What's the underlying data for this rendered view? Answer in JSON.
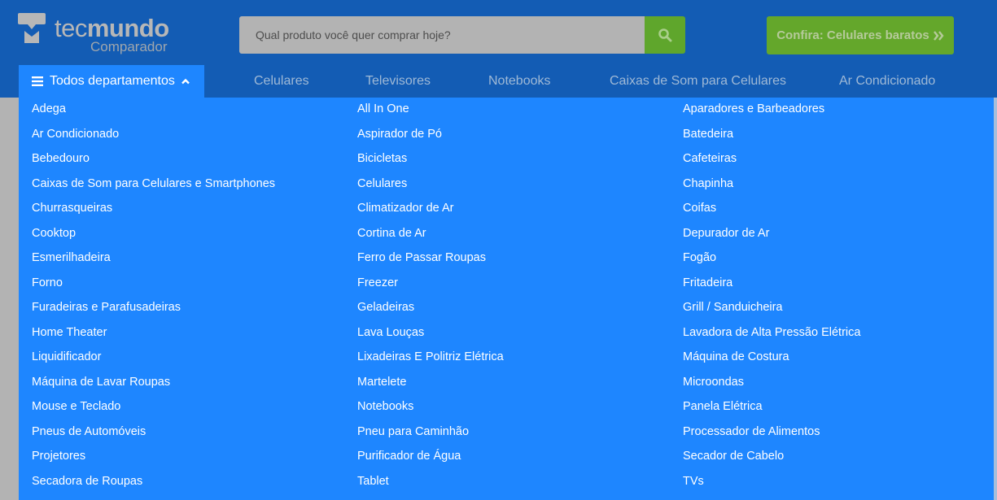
{
  "header": {
    "logo": {
      "brand_light": "tec",
      "brand_bold": "mundo",
      "subtitle": "Comparador"
    },
    "search": {
      "placeholder": "Qual produto você quer comprar hoje?",
      "value": "",
      "icon": "search-icon"
    },
    "promo_button": {
      "label": "Confira: Celulares baratos",
      "icon": "double-chevron-right-icon"
    }
  },
  "nav": {
    "departments_button": {
      "label": "Todos departamentos",
      "icon_left": "menu-icon",
      "icon_right": "chevron-up-icon",
      "expanded": true
    },
    "links": [
      "Celulares",
      "Televisores",
      "Notebooks",
      "Caixas de Som para Celulares",
      "Ar Condicionado"
    ]
  },
  "dropdown": {
    "columns": [
      [
        "Adega",
        "Ar Condicionado",
        "Bebedouro",
        "Caixas de Som para Celulares e Smartphones",
        "Churrasqueiras",
        "Cooktop",
        "Esmerilhadeira",
        "Forno",
        "Furadeiras e Parafusadeiras",
        "Home Theater",
        "Liquidificador",
        "Máquina de Lavar Roupas",
        "Mouse e Teclado",
        "Pneus de Automóveis",
        "Projetores",
        "Secadora de Roupas"
      ],
      [
        "All In One",
        "Aspirador de Pó",
        "Bicicletas",
        "Celulares",
        "Climatizador de Ar",
        "Cortina de Ar",
        "Ferro de Passar Roupas",
        "Freezer",
        "Geladeiras",
        "Lava Louças",
        "Lixadeiras E Politriz Elétrica",
        "Martelete",
        "Notebooks",
        "Pneu para Caminhão",
        "Purificador de Água",
        "Tablet"
      ],
      [
        "Aparadores e Barbeadores",
        "Batedeira",
        "Cafeteiras",
        "Chapinha",
        "Coifas",
        "Depurador de Ar",
        "Fogão",
        "Fritadeira",
        "Grill / Sanduicheira",
        "Lavadora de Alta Pressão Elétrica",
        "Máquina de Costura",
        "Microondas",
        "Panela Elétrica",
        "Processador de Alimentos",
        "Secador de Cabelo",
        "TVs"
      ]
    ]
  },
  "colors": {
    "header_bg": "#135cb4",
    "dropdown_bg": "#1e86ff",
    "search_button": "#5fa62c",
    "promo_button": "#64a72b",
    "overlay_gray": "#b3b3b3"
  }
}
